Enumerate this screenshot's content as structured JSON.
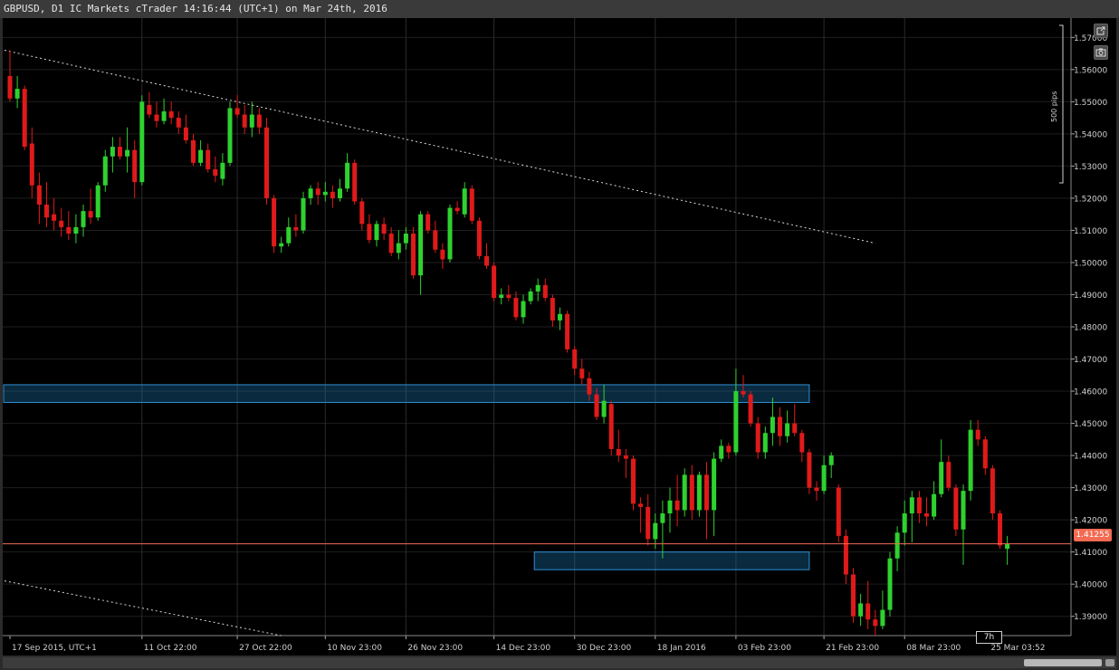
{
  "window": {
    "title": "GBPUSD, D1 IC Markets cTrader 14:16:44 (UTC+1) on Mar 24th, 2016"
  },
  "chart_data": {
    "type": "candlestick",
    "symbol": "GBPUSD",
    "timeframe": "D1",
    "ylim": [
      1.384,
      1.576
    ],
    "y_ticks": [
      "1.57000",
      "1.56000",
      "1.55000",
      "1.54000",
      "1.53000",
      "1.52000",
      "1.51000",
      "1.50000",
      "1.49000",
      "1.48000",
      "1.47000",
      "1.46000",
      "1.45000",
      "1.44000",
      "1.43000",
      "1.42000",
      "1.41000",
      "1.40000",
      "1.39000"
    ],
    "x_ticks": [
      "17 Sep 2015, UTC+1",
      "11 Oct 22:00",
      "27 Oct 22:00",
      "10 Nov 23:00",
      "26 Nov 23:00",
      "14 Dec 23:00",
      "30 Dec 23:00",
      "18 Jan 2016",
      "03 Feb 23:00",
      "21 Feb 23:00",
      "08 Mar 23:00",
      "25 Mar 03:52"
    ],
    "current_price": "1.41255",
    "pip_ruler_label": "500 pips",
    "period_label": "7h",
    "zones": [
      {
        "from_index": 0,
        "to_index": 109,
        "low": 1.4565,
        "high": 1.462
      },
      {
        "from_index": 72,
        "to_index": 109,
        "low": 1.4045,
        "high": 1.41
      }
    ],
    "trendlines": [
      {
        "from": [
          0,
          1.566
        ],
        "to": [
          118,
          1.506
        ]
      },
      {
        "from": [
          0,
          1.401
        ],
        "to": [
          37,
          1.384
        ]
      }
    ],
    "candles": [
      [
        1.558,
        1.566,
        1.55,
        1.551
      ],
      [
        1.551,
        1.558,
        1.548,
        1.554
      ],
      [
        1.554,
        1.555,
        1.535,
        1.536
      ],
      [
        1.537,
        1.542,
        1.52,
        1.524
      ],
      [
        1.524,
        1.528,
        1.512,
        1.518
      ],
      [
        1.518,
        1.525,
        1.511,
        1.514
      ],
      [
        1.515,
        1.52,
        1.51,
        1.513
      ],
      [
        1.513,
        1.517,
        1.508,
        1.511
      ],
      [
        1.511,
        1.516,
        1.507,
        1.509
      ],
      [
        1.509,
        1.515,
        1.506,
        1.511
      ],
      [
        1.511,
        1.518,
        1.508,
        1.516
      ],
      [
        1.516,
        1.523,
        1.512,
        1.514
      ],
      [
        1.514,
        1.525,
        1.513,
        1.524
      ],
      [
        1.524,
        1.535,
        1.522,
        1.533
      ],
      [
        1.533,
        1.539,
        1.528,
        1.536
      ],
      [
        1.536,
        1.539,
        1.532,
        1.533
      ],
      [
        1.533,
        1.542,
        1.528,
        1.535
      ],
      [
        1.535,
        1.538,
        1.52,
        1.525
      ],
      [
        1.525,
        1.552,
        1.524,
        1.55
      ],
      [
        1.549,
        1.553,
        1.545,
        1.546
      ],
      [
        1.546,
        1.55,
        1.542,
        1.544
      ],
      [
        1.544,
        1.551,
        1.543,
        1.547
      ],
      [
        1.547,
        1.55,
        1.543,
        1.545
      ],
      [
        1.545,
        1.547,
        1.54,
        1.542
      ],
      [
        1.542,
        1.546,
        1.537,
        1.538
      ],
      [
        1.538,
        1.54,
        1.53,
        1.531
      ],
      [
        1.531,
        1.538,
        1.53,
        1.535
      ],
      [
        1.535,
        1.537,
        1.528,
        1.529
      ],
      [
        1.529,
        1.533,
        1.525,
        1.527
      ],
      [
        1.526,
        1.534,
        1.524,
        1.531
      ],
      [
        1.531,
        1.55,
        1.53,
        1.548
      ],
      [
        1.548,
        1.552,
        1.545,
        1.546
      ],
      [
        1.546,
        1.549,
        1.54,
        1.542
      ],
      [
        1.542,
        1.55,
        1.539,
        1.546
      ],
      [
        1.546,
        1.548,
        1.54,
        1.542
      ],
      [
        1.542,
        1.545,
        1.518,
        1.52
      ],
      [
        1.52,
        1.521,
        1.503,
        1.505
      ],
      [
        1.505,
        1.508,
        1.503,
        1.506
      ],
      [
        1.506,
        1.514,
        1.505,
        1.511
      ],
      [
        1.511,
        1.515,
        1.508,
        1.51
      ],
      [
        1.51,
        1.522,
        1.509,
        1.52
      ],
      [
        1.52,
        1.524,
        1.518,
        1.523
      ],
      [
        1.523,
        1.525,
        1.518,
        1.521
      ],
      [
        1.521,
        1.525,
        1.519,
        1.522
      ],
      [
        1.522,
        1.524,
        1.517,
        1.52
      ],
      [
        1.52,
        1.526,
        1.519,
        1.523
      ],
      [
        1.523,
        1.534,
        1.522,
        1.531
      ],
      [
        1.531,
        1.532,
        1.518,
        1.519
      ],
      [
        1.519,
        1.52,
        1.51,
        1.512
      ],
      [
        1.512,
        1.515,
        1.506,
        1.507
      ],
      [
        1.507,
        1.513,
        1.505,
        1.512
      ],
      [
        1.512,
        1.514,
        1.507,
        1.509
      ],
      [
        1.509,
        1.511,
        1.502,
        1.503
      ],
      [
        1.503,
        1.51,
        1.501,
        1.506
      ],
      [
        1.506,
        1.511,
        1.504,
        1.509
      ],
      [
        1.509,
        1.511,
        1.495,
        1.496
      ],
      [
        1.496,
        1.516,
        1.49,
        1.515
      ],
      [
        1.515,
        1.516,
        1.509,
        1.51
      ],
      [
        1.51,
        1.513,
        1.503,
        1.504
      ],
      [
        1.504,
        1.506,
        1.498,
        1.501
      ],
      [
        1.501,
        1.518,
        1.5,
        1.517
      ],
      [
        1.517,
        1.519,
        1.515,
        1.516
      ],
      [
        1.515,
        1.525,
        1.514,
        1.523
      ],
      [
        1.523,
        1.524,
        1.512,
        1.513
      ],
      [
        1.513,
        1.514,
        1.501,
        1.502
      ],
      [
        1.502,
        1.506,
        1.498,
        1.499
      ],
      [
        1.499,
        1.5,
        1.488,
        1.489
      ],
      [
        1.489,
        1.492,
        1.487,
        1.49
      ],
      [
        1.49,
        1.493,
        1.488,
        1.489
      ],
      [
        1.489,
        1.491,
        1.482,
        1.483
      ],
      [
        1.483,
        1.49,
        1.481,
        1.488
      ],
      [
        1.488,
        1.492,
        1.487,
        1.491
      ],
      [
        1.491,
        1.495,
        1.488,
        1.493
      ],
      [
        1.493,
        1.495,
        1.488,
        1.489
      ],
      [
        1.489,
        1.49,
        1.48,
        1.482
      ],
      [
        1.482,
        1.486,
        1.479,
        1.484
      ],
      [
        1.484,
        1.485,
        1.472,
        1.473
      ],
      [
        1.473,
        1.474,
        1.465,
        1.467
      ],
      [
        1.467,
        1.47,
        1.462,
        1.464
      ],
      [
        1.464,
        1.466,
        1.457,
        1.459
      ],
      [
        1.459,
        1.461,
        1.451,
        1.452
      ],
      [
        1.452,
        1.462,
        1.45,
        1.457
      ],
      [
        1.456,
        1.457,
        1.44,
        1.442
      ],
      [
        1.442,
        1.448,
        1.438,
        1.44
      ],
      [
        1.44,
        1.442,
        1.433,
        1.439
      ],
      [
        1.439,
        1.44,
        1.423,
        1.425
      ],
      [
        1.425,
        1.427,
        1.416,
        1.424
      ],
      [
        1.424,
        1.428,
        1.412,
        1.414
      ],
      [
        1.414,
        1.422,
        1.411,
        1.419
      ],
      [
        1.419,
        1.426,
        1.408,
        1.422
      ],
      [
        1.422,
        1.43,
        1.416,
        1.426
      ],
      [
        1.426,
        1.434,
        1.418,
        1.423
      ],
      [
        1.423,
        1.436,
        1.421,
        1.434
      ],
      [
        1.434,
        1.437,
        1.42,
        1.423
      ],
      [
        1.423,
        1.435,
        1.421,
        1.434
      ],
      [
        1.434,
        1.438,
        1.414,
        1.423
      ],
      [
        1.423,
        1.441,
        1.415,
        1.439
      ],
      [
        1.439,
        1.445,
        1.438,
        1.443
      ],
      [
        1.443,
        1.444,
        1.439,
        1.441
      ],
      [
        1.441,
        1.467,
        1.44,
        1.46
      ],
      [
        1.46,
        1.465,
        1.458,
        1.459
      ],
      [
        1.459,
        1.46,
        1.449,
        1.45
      ],
      [
        1.45,
        1.452,
        1.439,
        1.441
      ],
      [
        1.441,
        1.449,
        1.439,
        1.447
      ],
      [
        1.447,
        1.458,
        1.443,
        1.452
      ],
      [
        1.452,
        1.455,
        1.443,
        1.446
      ],
      [
        1.446,
        1.454,
        1.444,
        1.45
      ],
      [
        1.45,
        1.456,
        1.446,
        1.447
      ],
      [
        1.447,
        1.448,
        1.438,
        1.441
      ],
      [
        1.441,
        1.442,
        1.428,
        1.43
      ],
      [
        1.43,
        1.432,
        1.426,
        1.429
      ],
      [
        1.429,
        1.44,
        1.428,
        1.437
      ],
      [
        1.437,
        1.441,
        1.433,
        1.44
      ],
      [
        1.43,
        1.431,
        1.413,
        1.415
      ],
      [
        1.415,
        1.417,
        1.4,
        1.403
      ],
      [
        1.403,
        1.405,
        1.388,
        1.39
      ],
      [
        1.39,
        1.397,
        1.387,
        1.394
      ],
      [
        1.394,
        1.401,
        1.386,
        1.389
      ],
      [
        1.389,
        1.392,
        1.384,
        1.387
      ],
      [
        1.387,
        1.398,
        1.386,
        1.392
      ],
      [
        1.392,
        1.41,
        1.39,
        1.408
      ],
      [
        1.408,
        1.418,
        1.404,
        1.416
      ],
      [
        1.416,
        1.426,
        1.412,
        1.422
      ],
      [
        1.422,
        1.429,
        1.413,
        1.427
      ],
      [
        1.427,
        1.429,
        1.419,
        1.422
      ],
      [
        1.422,
        1.427,
        1.418,
        1.421
      ],
      [
        1.421,
        1.432,
        1.42,
        1.428
      ],
      [
        1.428,
        1.445,
        1.427,
        1.438
      ],
      [
        1.438,
        1.44,
        1.429,
        1.43
      ],
      [
        1.43,
        1.431,
        1.415,
        1.417
      ],
      [
        1.417,
        1.431,
        1.406,
        1.429
      ],
      [
        1.429,
        1.451,
        1.426,
        1.448
      ],
      [
        1.448,
        1.451,
        1.443,
        1.445
      ],
      [
        1.445,
        1.446,
        1.434,
        1.436
      ],
      [
        1.436,
        1.437,
        1.42,
        1.422
      ],
      [
        1.422,
        1.423,
        1.411,
        1.412
      ],
      [
        1.411,
        1.415,
        1.406,
        1.4125
      ]
    ]
  }
}
